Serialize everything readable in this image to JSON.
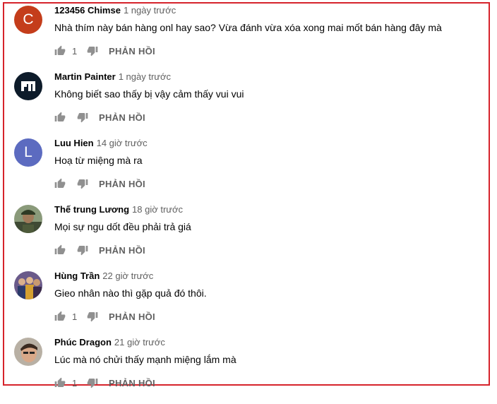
{
  "colors": {
    "border": "#d6232b",
    "author": "#030303",
    "meta": "#606060",
    "icon": "#909090"
  },
  "comments": [
    {
      "author": "123456 Chimse",
      "time": "1 ngày trước",
      "text": "Nhà thím này bán hàng onl hay sao? Vừa đánh vừa xóa xong mai mốt bán hàng đây mà",
      "likes": "1",
      "reply": "PHẢN HỒI",
      "avatar_letter": "C",
      "avatar_color": "#c43d1b",
      "avatar_kind": "letter"
    },
    {
      "author": "Martin Painter",
      "time": "1 ngày trước",
      "text": "Không biết sao thấy bị vậy cảm thấy vui vui",
      "likes": "",
      "reply": "PHẢN HỒI",
      "avatar_letter": "MT",
      "avatar_color": "#0d1b2a",
      "avatar_kind": "logo"
    },
    {
      "author": "Luu Hien",
      "time": "14 giờ trước",
      "text": "Hoạ từ miệng mà ra",
      "likes": "",
      "reply": "PHẢN HỒI",
      "avatar_letter": "L",
      "avatar_color": "#5c6bc0",
      "avatar_kind": "letter"
    },
    {
      "author": "Thế trung Lương",
      "time": "18 giờ trước",
      "text": "Mọi sự ngu dốt đều phải trả giá",
      "likes": "",
      "reply": "PHẢN HỒI",
      "avatar_letter": "",
      "avatar_color": "#5a6b4a",
      "avatar_kind": "photo-soldier"
    },
    {
      "author": "Hùng Trần",
      "time": "22 giờ trước",
      "text": "Gieo nhân nào thì gặp quả đó thôi.",
      "likes": "1",
      "reply": "PHẢN HỒI",
      "avatar_letter": "",
      "avatar_color": "#7a6a8a",
      "avatar_kind": "photo-group"
    },
    {
      "author": "Phúc Dragon",
      "time": "21 giờ trước",
      "text": "Lúc mà nó chửi thấy mạnh miệng lắm mà",
      "likes": "1",
      "reply": "PHẢN HỒI",
      "avatar_letter": "",
      "avatar_color": "#8a7a6a",
      "avatar_kind": "photo-face"
    }
  ]
}
